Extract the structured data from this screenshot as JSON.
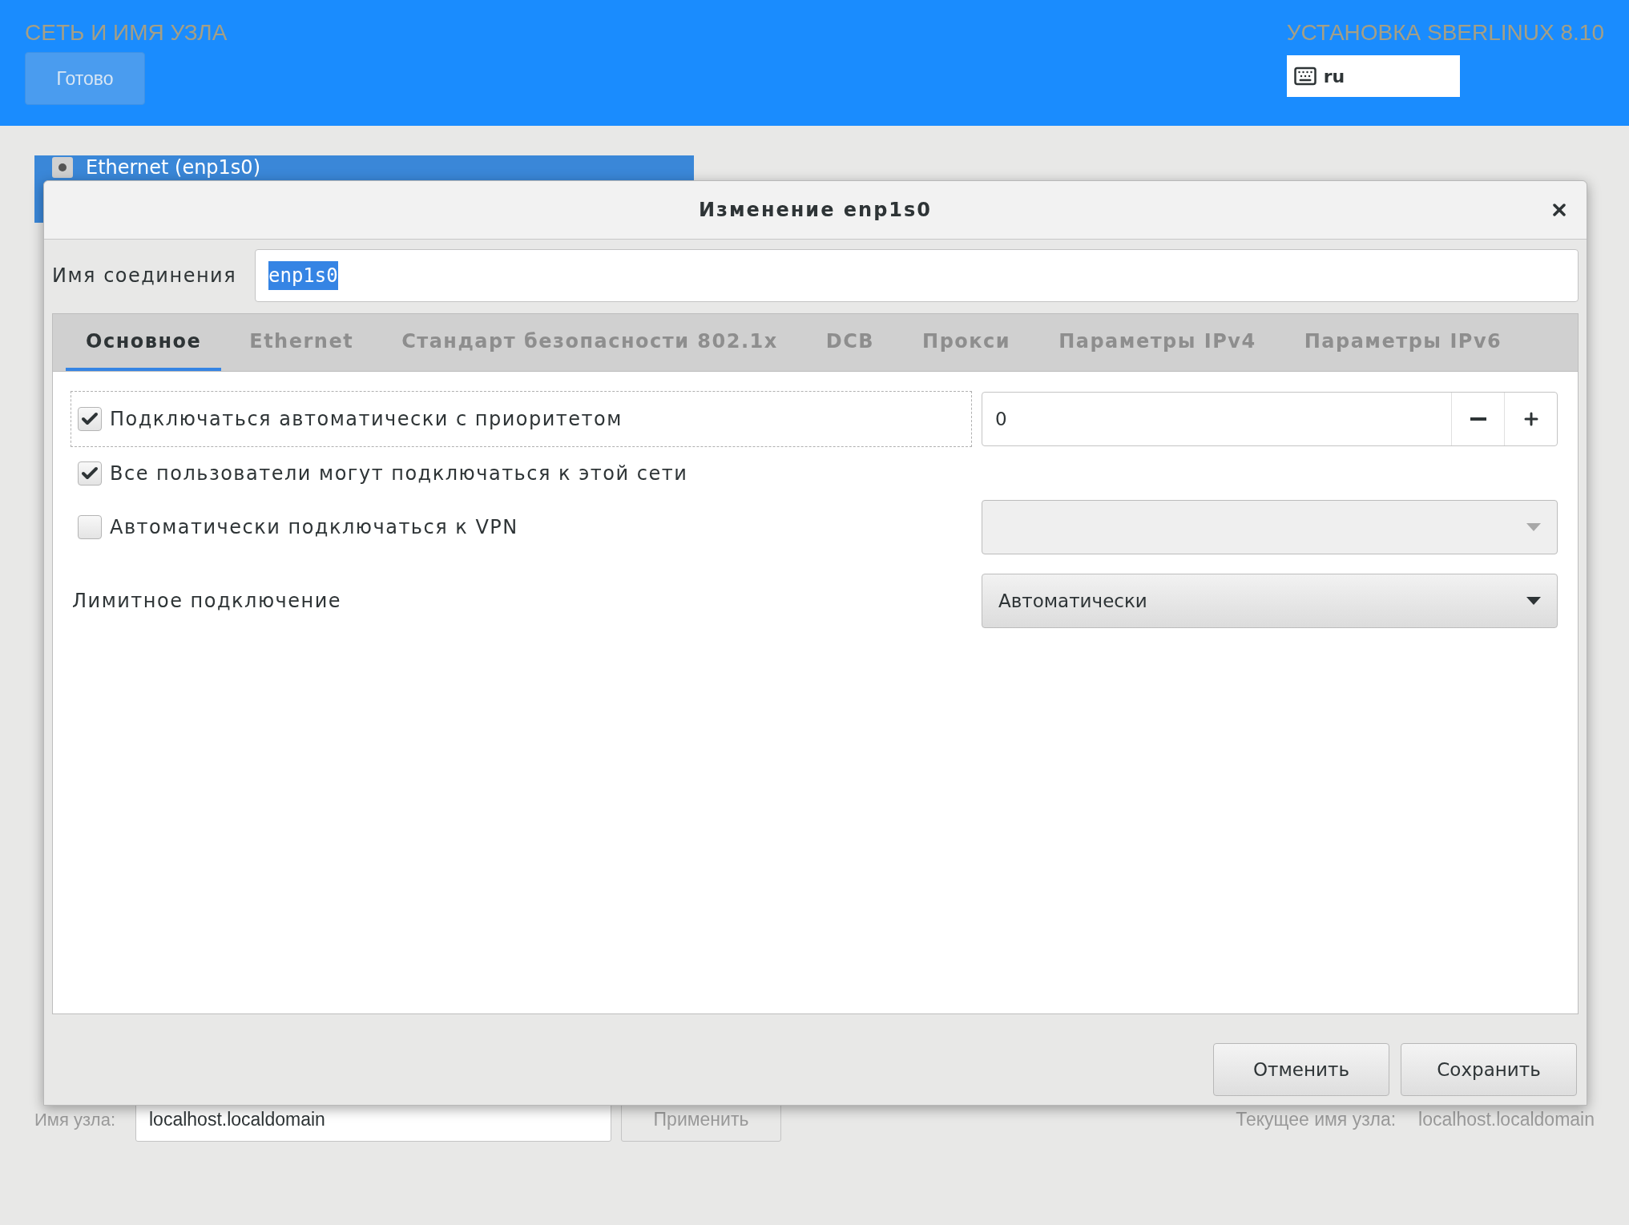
{
  "header": {
    "title": "СЕТЬ И ИМЯ УЗЛА",
    "done_button": "Готово",
    "product": "УСТАНОВКА SBERLINUX 8.10",
    "keyboard_layout": "ru"
  },
  "background": {
    "device_item": "Ethernet (enp1s0)",
    "hostname_label": "Имя узла:",
    "hostname_value": "localhost.localdomain",
    "apply_button": "Применить",
    "current_hostname_label": "Текущее имя узла:",
    "current_hostname": "localhost.localdomain"
  },
  "dialog": {
    "title": "Изменение enp1s0",
    "connection_name": {
      "label": "Имя соединения",
      "value": "enp1s0",
      "text_selected": true
    },
    "tabs": [
      {
        "label": "Основное",
        "selected": true
      },
      {
        "label": "Ethernet",
        "selected": false
      },
      {
        "label": "Стандарт безопасности 802.1x",
        "selected": false
      },
      {
        "label": "DCB",
        "selected": false
      },
      {
        "label": "Прокси",
        "selected": false
      },
      {
        "label": "Параметры IPv4",
        "selected": false
      },
      {
        "label": "Параметры IPv6",
        "selected": false
      }
    ],
    "rows": [
      {
        "kind": "checkbox",
        "label": "Подключаться автоматически с приоритетом",
        "checked": true,
        "focused": true,
        "control": {
          "kind": "spin",
          "value": "0"
        }
      },
      {
        "kind": "checkbox",
        "label": "Все пользователи могут подключаться к этой сети",
        "checked": true,
        "focused": false
      },
      {
        "kind": "checkbox",
        "label": "Автоматически подключаться к VPN",
        "checked": false,
        "focused": false,
        "control": {
          "kind": "combo",
          "disabled": true
        }
      },
      {
        "kind": "label",
        "label": "Лимитное подключение",
        "control": {
          "kind": "combo",
          "disabled": false,
          "value": "Автоматически"
        }
      }
    ],
    "buttons": [
      "Отменить",
      "Сохранить"
    ]
  }
}
